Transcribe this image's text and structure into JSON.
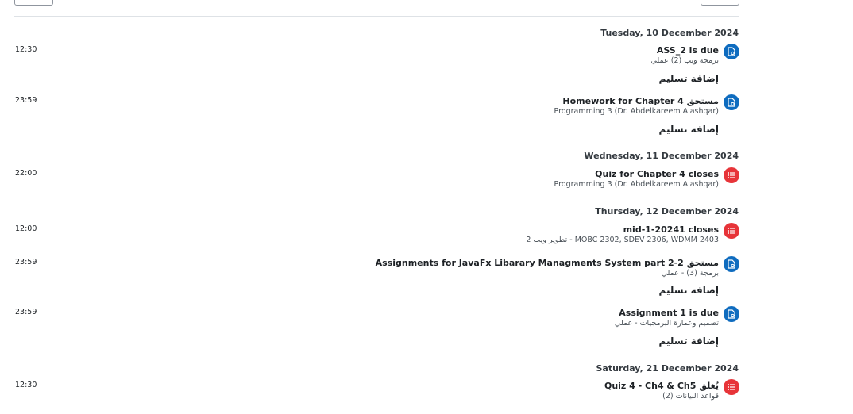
{
  "days": [
    {
      "date": "Tuesday, 10 December 2024",
      "events": [
        {
          "time": "12:30",
          "title": "ASS_2 is due",
          "course": "برمجة ويب (2) عملي",
          "type": "assignment",
          "action": "إضافة تسليم"
        },
        {
          "time": "23:59",
          "title": "Homework for Chapter 4 مستحق",
          "course": "Programming 3 (Dr. Abdelkareem Alashqar)",
          "type": "assignment",
          "action": "إضافة تسليم"
        }
      ]
    },
    {
      "date": "Wednesday, 11 December 2024",
      "events": [
        {
          "time": "22:00",
          "title": "Quiz for Chapter 4 closes",
          "course": "Programming 3 (Dr. Abdelkareem Alashqar)",
          "type": "quiz",
          "action": ""
        }
      ]
    },
    {
      "date": "Thursday, 12 December 2024",
      "events": [
        {
          "time": "12:00",
          "title": "mid-1-20241 closes",
          "course": "تطوير ويب 2 - MOBC 2302, SDEV 2306, WDMM 2403",
          "type": "quiz",
          "action": ""
        },
        {
          "time": "23:59",
          "title": "Assignments for JavaFx Libarary Managments System part 2-2 مستحق",
          "course": "برمجة (3) - عملي",
          "type": "assignment",
          "action": "إضافة تسليم"
        },
        {
          "time": "23:59",
          "title": "Assignment 1 is due",
          "course": "تصميم وعمارة البرمجيات - عملي",
          "type": "assignment",
          "action": "إضافة تسليم"
        }
      ]
    },
    {
      "date": "Saturday, 21 December 2024",
      "events": [
        {
          "time": "12:30",
          "title": "Quiz 4 - Ch4 & Ch5 يُغلق",
          "course": "قواعد البيانات (2)",
          "type": "quiz",
          "action": ""
        }
      ]
    }
  ],
  "icons": {
    "assignment": "assignment-icon",
    "quiz": "quiz-icon"
  },
  "colors": {
    "assignment": "#0f6cbf",
    "quiz": "#e73439"
  }
}
